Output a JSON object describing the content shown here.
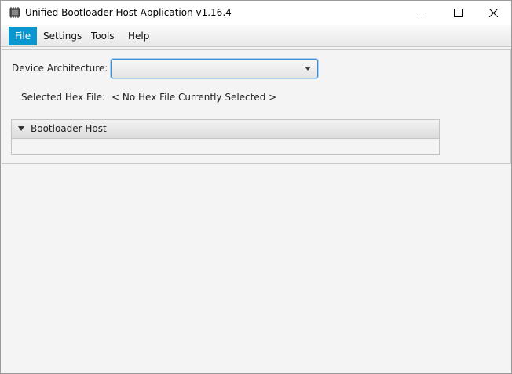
{
  "window": {
    "title": "Unified Bootloader Host Application v1.16.4",
    "icon": "chip-icon",
    "controls": {
      "minimize": "minimize-icon",
      "maximize": "maximize-icon",
      "close": "close-icon"
    }
  },
  "menubar": {
    "items": [
      {
        "label": "File",
        "active": true
      },
      {
        "label": "Settings",
        "active": false
      },
      {
        "label": "Tools",
        "active": false
      },
      {
        "label": "Help",
        "active": false
      }
    ]
  },
  "form": {
    "device_architecture_label": "Device Architecture:",
    "device_architecture_value": "",
    "selected_hex_label": "Selected Hex File:",
    "selected_hex_value": "< No Hex File Currently Selected >"
  },
  "bootloader_pane": {
    "title": "Bootloader Host",
    "expanded": true
  },
  "colors": {
    "menu_active_bg": "#0996d1",
    "focus_border": "#3a8fd8",
    "background": "#f4f4f4"
  }
}
